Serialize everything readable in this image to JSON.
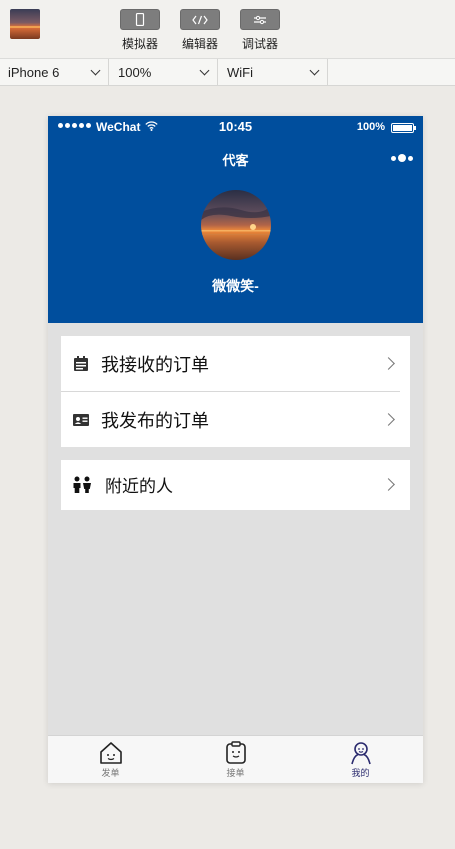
{
  "ide": {
    "toolbar": {
      "simulator_label": "模拟器",
      "editor_label": "编辑器",
      "debugger_label": "调试器"
    },
    "selectors": {
      "device": "iPhone 6",
      "zoom": "100%",
      "network": "WiFi"
    }
  },
  "phone": {
    "status_bar": {
      "carrier": "WeChat",
      "time": "10:45",
      "battery": "100%"
    },
    "nav": {
      "title": "代客"
    },
    "profile": {
      "nickname": "微微笑-"
    },
    "menu": {
      "received_orders": "我接收的订单",
      "published_orders": "我发布的订单",
      "nearby_people": "附近的人"
    },
    "tabbar": {
      "items": [
        {
          "label": "发单",
          "icon": "house-face-icon"
        },
        {
          "label": "接单",
          "icon": "clipboard-face-icon"
        },
        {
          "label": "我的",
          "icon": "person-icon"
        }
      ],
      "active_index": 2,
      "active_color": "#2b2b6e"
    },
    "colors": {
      "header": "#004e9d",
      "background": "#e0e0e0"
    }
  }
}
